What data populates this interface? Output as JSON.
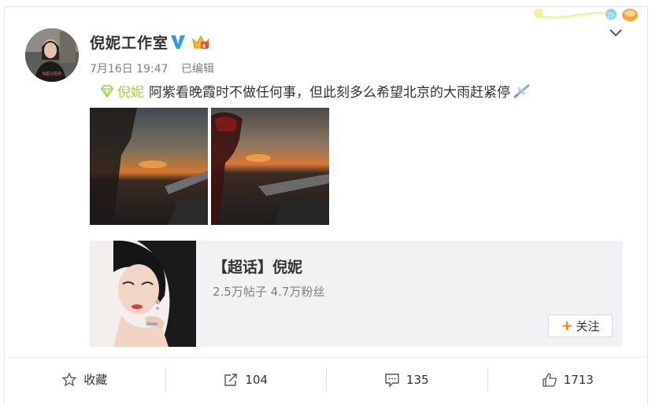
{
  "post": {
    "author": "倪妮工作室",
    "timestamp": "7月16日 19:47",
    "edited_label": "已编辑",
    "topic": "倪妮",
    "text": "阿紫看晚霞时不做任何事，但此刻多么希望北京的大雨赶紧停"
  },
  "super_topic": {
    "title": "【超话】倪妮",
    "stats": "2.5万帖子 4.7万粉丝",
    "follow_label": "关注"
  },
  "actions": {
    "favorite_label": "收藏",
    "share_count": "104",
    "comment_count": "135",
    "like_count": "1713"
  },
  "icons": {
    "verified": "verified-v-icon",
    "member": "crown-icon",
    "topic": "diamond-icon",
    "emoji": "airplane-icon",
    "favorite": "star-icon",
    "share": "share-icon",
    "comment": "comment-icon",
    "like": "thumbs-up-icon",
    "menu": "chevron-down-icon"
  },
  "colors": {
    "topic_link": "#a3cf40",
    "verified": "#2b9be2",
    "follow_plus": "#ff8200",
    "muted_text": "#808080"
  }
}
